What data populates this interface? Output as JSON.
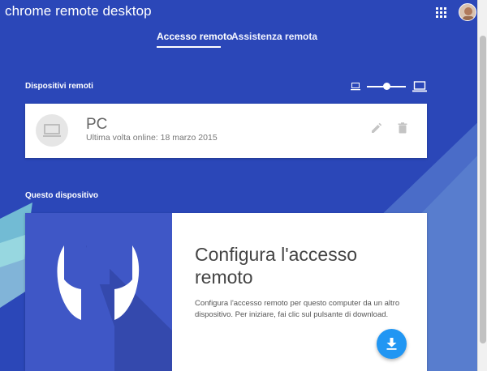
{
  "app": {
    "title": "chrome remote desktop"
  },
  "header": {
    "apps_icon": "apps-grid-icon",
    "avatar": "user-avatar"
  },
  "tabs": [
    {
      "label": "Accesso remoto",
      "active": true
    },
    {
      "label": "Assistenza remota",
      "active": false
    }
  ],
  "remote_devices": {
    "section_label": "Dispositivi remoti",
    "size_slider": {
      "min_icon": "small-laptop-icon",
      "max_icon": "large-laptop-icon",
      "level": 0.6
    },
    "devices": [
      {
        "name": "PC",
        "status": "Ultima volta online: 18 marzo 2015",
        "icon": "computer-icon",
        "actions": [
          "edit-pencil-icon",
          "delete-trash-icon"
        ]
      }
    ]
  },
  "this_device": {
    "section_label": "Questo dispositivo",
    "card": {
      "title": "Configura l'accesso remoto",
      "description": "Configura l'accesso remoto per questo computer da un altro dispositivo. Per iniziare, fai clic sul pulsante di download.",
      "hero_icon": "wrench-icon",
      "button_icon": "download-icon"
    }
  },
  "colors": {
    "background": "#2b47b8",
    "accent": "#2196f3",
    "hero": "#3f57c6"
  }
}
